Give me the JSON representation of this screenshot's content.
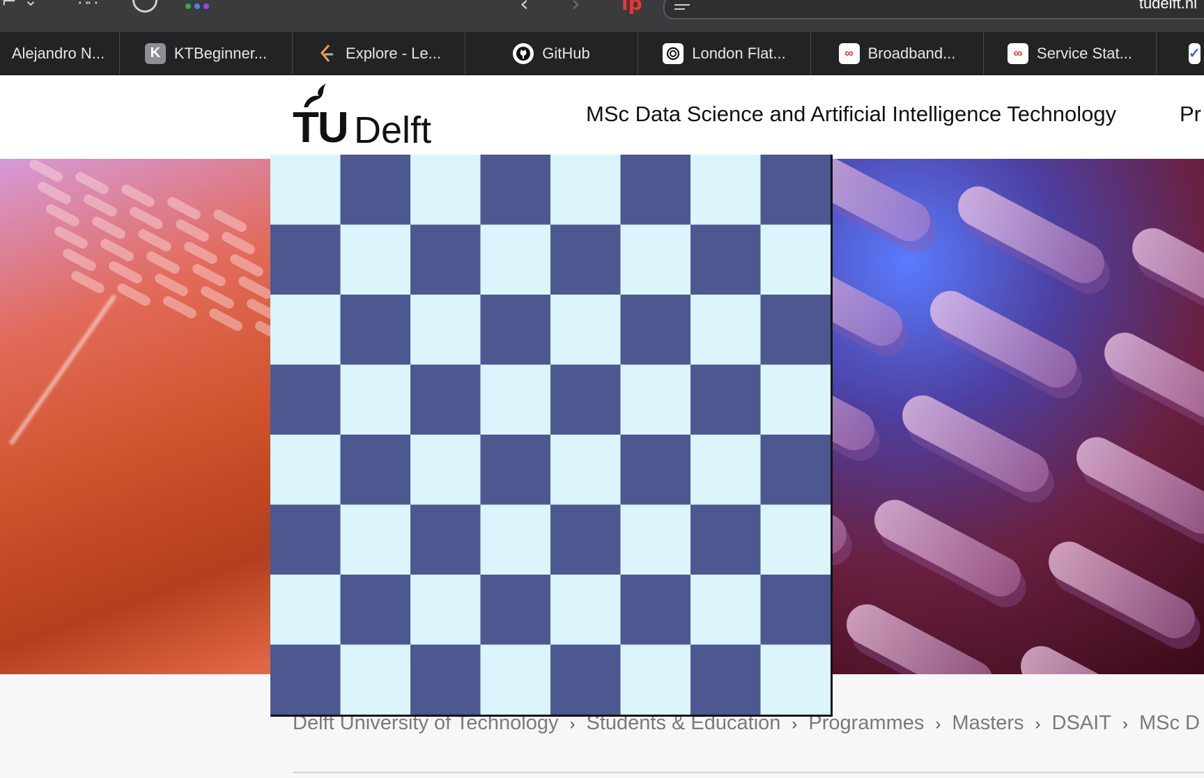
{
  "browser": {
    "address_text": "tudelft.nl",
    "bookmarks": [
      {
        "label": "Alejandro N...",
        "icon": "none"
      },
      {
        "label": "KTBeginner...",
        "icon": "k-icon",
        "glyph": "K"
      },
      {
        "label": "Explore - Le...",
        "icon": "leetcode-icon"
      },
      {
        "label": "GitHub",
        "icon": "github-icon"
      },
      {
        "label": "London Flat...",
        "icon": "chatgpt-icon"
      },
      {
        "label": "Broadband...",
        "icon": "infinity-icon"
      },
      {
        "label": "Service Stat...",
        "icon": "infinity-icon"
      }
    ]
  },
  "site": {
    "logo_tu": "TU",
    "logo_delft": "Delft",
    "nav_title": "MSc Data Science and Artificial Intelligence Technology",
    "nav_more": "Pr"
  },
  "breadcrumb": [
    "Delft University of Technology",
    "Students & Education",
    "Programmes",
    "Masters",
    "DSAIT",
    "MSc D"
  ],
  "chessboard": {
    "rows": 8,
    "cols": 8,
    "light_color": "#dcf4fc",
    "dark_color": "#4e5890"
  }
}
